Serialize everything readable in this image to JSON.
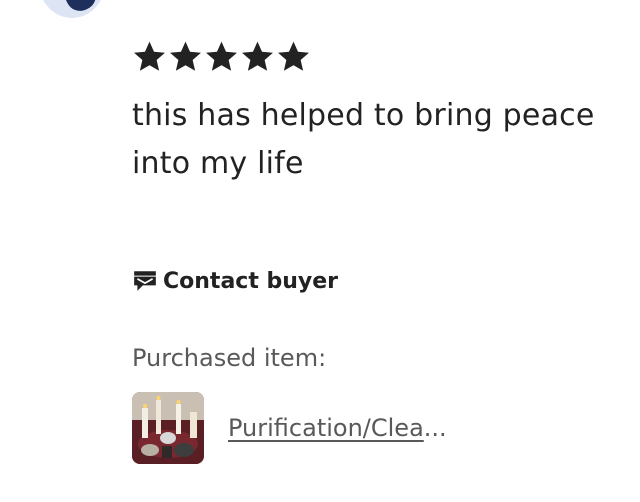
{
  "reviewer": {
    "avatar_icon": "user-avatar"
  },
  "review": {
    "rating": 5,
    "rating_max": 5,
    "star_symbol": "★",
    "text": "this has helped to bring peace into my life"
  },
  "contact": {
    "icon": "message-flag-icon",
    "label": "Contact buyer"
  },
  "purchase": {
    "label": "Purchased item:",
    "item_title": "Purification/Clea",
    "truncation": "...",
    "thumbnail_icon": "candles-product-image"
  },
  "colors": {
    "text": "#222222",
    "muted": "#595959",
    "avatar_bg": "#dde4f3",
    "avatar_fg": "#1f2f5c"
  }
}
